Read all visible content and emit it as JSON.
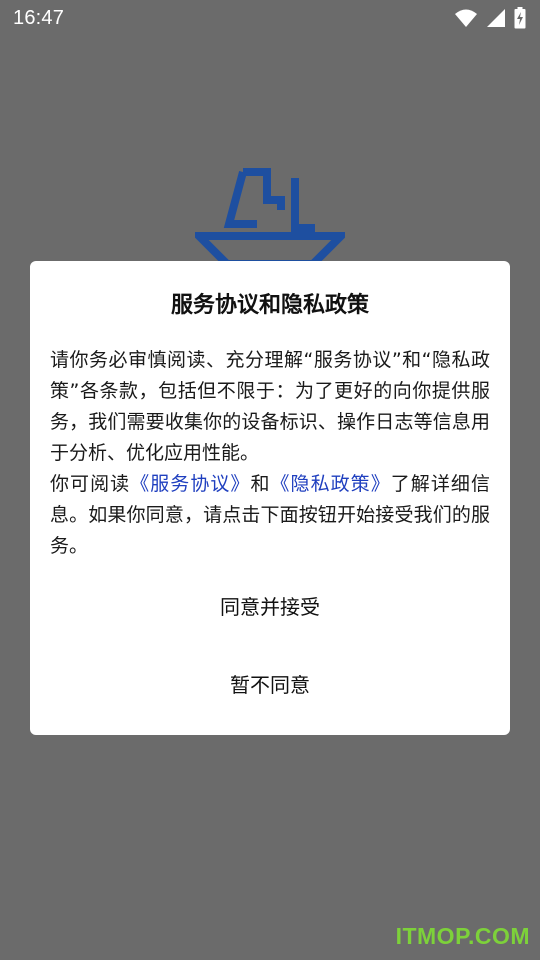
{
  "status_bar": {
    "time": "16:47",
    "icons": [
      "wifi-icon",
      "signal-icon",
      "battery-charging-icon"
    ]
  },
  "dialog": {
    "title": "服务协议和隐私政策",
    "paragraph1": "请你务必审慎阅读、充分理解“服务协议”和“隐私政策”各条款，包括但不限于：为了更好的向你提供服务，我们需要收集你的设备标识、操作日志等信息用于分析、优化应用性能。",
    "paragraph2_prefix": "你可阅读",
    "service_link": "《服务协议》",
    "paragraph2_and": "和",
    "privacy_link": "《隐私政策》",
    "paragraph2_suffix": "了解详细信息。如果你同意，请点击下面按钮开始接受我们的服务。",
    "accept_label": "同意并接受",
    "decline_label": "暂不同意"
  },
  "watermark": "ITMOP.COM",
  "colors": {
    "overlay": "#6b6b6b",
    "link": "#1f3fbf",
    "logo": "#1e4fa0",
    "watermark": "#7dd13a"
  }
}
